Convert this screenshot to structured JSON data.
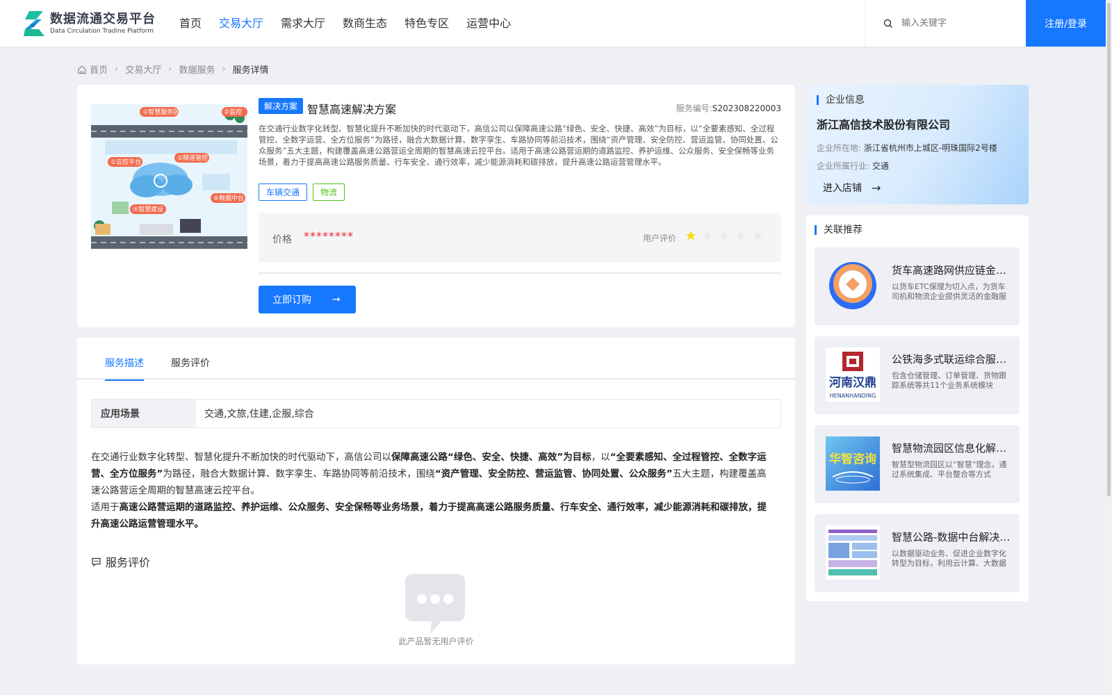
{
  "header": {
    "logo_cn": "数据流通交易平台",
    "logo_en": "Data Circulation Tradine Platform",
    "nav": [
      "首页",
      "交易大厅",
      "需求大厅",
      "数商生态",
      "特色专区",
      "运营中心"
    ],
    "active_nav": "交易大厅",
    "search_placeholder": "输入关键字",
    "login_label": "注册/登录"
  },
  "breadcrumb": [
    "首页",
    "交易大厅",
    "数据服务",
    "服务详情"
  ],
  "product": {
    "type_tag": "解决方案",
    "title": "智慧高速解决方案",
    "service_no_label": "服务编号:",
    "service_no": "S202308220003",
    "description": "在交通行业数字化转型、智慧化提升不断加快的时代驱动下，高信公司以保障高速公路“绿色、安全、快捷、高效”为目标，以“全要素感知、全过程管控、全数字运营、全方位服务”为路径，融合大数据计算、数字孪生、车路协同等前沿技术，围绕“资产管理、安全防控、营运监管、协同处置、公众服务”五大主题，构建覆盖高速公路营运全周期的智慧高速云控平台。适用于高速公路营运期的道路监控、养护运维、公众服务、安全保畅等业务场景，着力于提高高速公路服务质量、行车安全、通行效率，减少能源消耗和碳排放，提升高速公路运营管理水平。",
    "tags": [
      "车辆交通",
      "物流"
    ],
    "price_label": "价格",
    "price_value": "********",
    "rating_label": "用户评价",
    "rating": 1,
    "rating_max": 5,
    "order_label": "立即订购",
    "image_labels": [
      "①智慧服务区",
      "②监控",
      "①云控平台",
      "①隧道管控",
      "⑤智慧建设",
      "⑥数据中台"
    ]
  },
  "company": {
    "section_title": "企业信息",
    "name": "浙江高信技术股份有限公司",
    "location_label": "企业所在地:",
    "location": "浙江省杭州市上城区-明珠国际2号楼",
    "industry_label": "企业所属行业:",
    "industry": "交通",
    "shop_label": "进入店铺"
  },
  "related": {
    "section_title": "关联推荐",
    "items": [
      {
        "title": "货车高速路网供应链金融服务",
        "desc": "以货车ETC保理为切入点，为货车司机和物流企业提供灵活的金融服务",
        "thumb": "ring"
      },
      {
        "title": "公铁海多式联运综合服务平台",
        "desc": "包含仓储管理、订单管理、货物跟踪系统等共11个业务系统模块",
        "thumb": "handing",
        "thumb_text": "河南汉鼎",
        "thumb_sub": "HENANHANDING"
      },
      {
        "title": "智慧物流园区信息化解决方案",
        "desc": "智慧型物流园区以“智慧”理念，通过系统集成、平台整合等方式",
        "thumb": "huazhi",
        "thumb_text": "华智咨询"
      },
      {
        "title": "智慧公路-数据中台解决方案",
        "desc": "以数据驱动业务、促进企业数字化转型为目标，利用云计算、大数据",
        "thumb": "diagram"
      }
    ]
  },
  "detail": {
    "tabs": [
      "服务描述",
      "服务评价"
    ],
    "active_tab": "服务描述",
    "scene_label": "应用场景",
    "scene_value": "交通,文旅,住建,企服,综合",
    "para1": [
      {
        "t": "在交通行业数字化转型、智慧化提升不断加快的时代驱动下，高信公司以",
        "b": false
      },
      {
        "t": "保障高速公路“绿色、安全、快捷、高效”为目标",
        "b": true
      },
      {
        "t": "，以",
        "b": false
      },
      {
        "t": "“全要素感知、全过程管控、全数字运营、全方位服务”",
        "b": true
      },
      {
        "t": "为路径，融合大数据计算、数字孪生、车路协同等前沿技术，围绕",
        "b": false
      },
      {
        "t": "“资产管理、安全防控、营运监管、协同处置、公众服务”",
        "b": true
      },
      {
        "t": "五大主题，构建覆盖高速公路营运全周期的智慧高速云控平台。",
        "b": false
      }
    ],
    "para2": [
      {
        "t": "适用于",
        "b": false
      },
      {
        "t": "高速公路营运期的道路监控、养护运维、公众服务、安全保畅等业务场景，着力于提高高速公路服务质量、行车安全、通行效率，减少能源消耗和碳排放，提升高速公路运营管理水平。",
        "b": true
      }
    ],
    "eval_title": "服务评价",
    "empty_text": "此产品暂无用户评价"
  },
  "colors": {
    "primary": "#1677ff",
    "price": "#f5222d",
    "star_on": "#fadb14",
    "star_off": "#e8e8e8"
  }
}
